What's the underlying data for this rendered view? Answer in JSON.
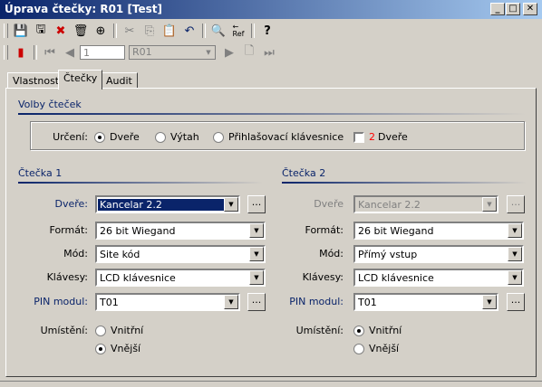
{
  "window": {
    "title": "Úprava čtečky: R01 [Test]"
  },
  "toolbar": {
    "record_input": "1",
    "record_combo": "R01"
  },
  "tabs": [
    {
      "label": "Vlastnosti"
    },
    {
      "label": "Čtečky"
    },
    {
      "label": "Audit"
    }
  ],
  "reader_options": {
    "section_title": "Volby čteček",
    "purpose_label": "Určení:",
    "purpose_options": [
      "Dveře",
      "Výtah",
      "Přihlašovací klávesnice"
    ],
    "purpose_selected": "Dveře",
    "two_doors_number": "2",
    "two_doors_label": "Dveře",
    "two_doors_checked": false
  },
  "reader1": {
    "title": "Čtečka 1",
    "door_label": "Dveře:",
    "door_value": "Kancelar 2.2",
    "format_label": "Formát:",
    "format_value": "26 bit Wiegand",
    "mode_label": "Mód:",
    "mode_value": "Site kód",
    "keypad_label": "Klávesy:",
    "keypad_value": "LCD klávesnice",
    "pin_label": "PIN modul:",
    "pin_value": "T01",
    "placement_label": "Umístění:",
    "placement_options": [
      "Vnitřní",
      "Vnější"
    ],
    "placement_selected": "Vnější",
    "ellipsis": "..."
  },
  "reader2": {
    "title": "Čtečka 2",
    "door_label": "Dveře",
    "door_value": "Kancelar 2.2",
    "format_label": "Formát:",
    "format_value": "26 bit Wiegand",
    "mode_label": "Mód:",
    "mode_value": "Přímý vstup",
    "keypad_label": "Klávesy:",
    "keypad_value": "LCD klávesnice",
    "pin_label": "PIN modul:",
    "pin_value": "T01",
    "placement_label": "Umístění:",
    "placement_options": [
      "Vnitřní",
      "Vnější"
    ],
    "placement_selected": "Vnitřní",
    "ellipsis": "..."
  },
  "colors": {
    "accent": "#0a246a",
    "face": "#d4d0c8",
    "two_number": "#ff0000"
  }
}
